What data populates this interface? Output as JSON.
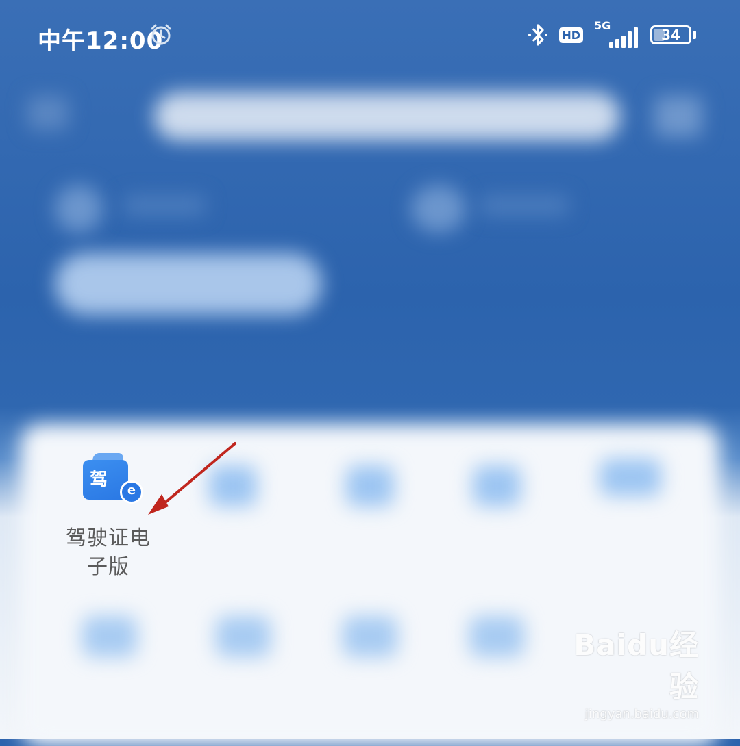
{
  "status_bar": {
    "time": "中午12:00",
    "network_label": "5G",
    "hd_label": "HD",
    "battery_level": "34"
  },
  "app": {
    "icon_glyph": "驾",
    "badge_glyph": "e",
    "label_line1": "驾驶证电",
    "label_line2": "子版"
  },
  "watermark": {
    "brand": "Bai",
    "brand_paw": "du",
    "brand_suffix": "经验",
    "url": "jingyan.baidu.com"
  }
}
